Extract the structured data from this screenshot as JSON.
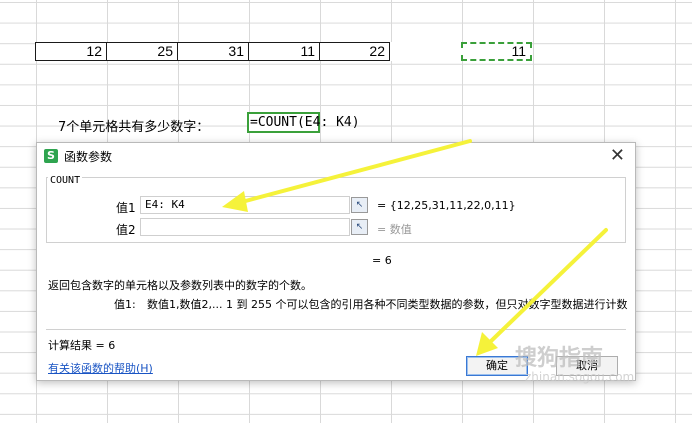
{
  "sheet": {
    "row_values": [
      "12",
      "25",
      "31",
      "11",
      "22",
      "",
      "11"
    ],
    "question": "7个单元格共有多少数字：",
    "formula": "=COUNT(E4: K4)"
  },
  "dialog": {
    "icon_label": "S",
    "title": "函数参数",
    "close_label": "✕",
    "function_name": "COUNT",
    "arg1_label": "值1",
    "arg1_value": "E4: K4",
    "arg1_result": "= {12,25,31,11,22,0,11}",
    "arg2_label": "值2",
    "arg2_value": "",
    "arg2_result": "= 数值",
    "ref_icon": "↖",
    "total_result": "= 6",
    "description": "返回包含数字的单元格以及参数列表中的数字的个数。",
    "param_name": "值1:",
    "param_description": "数值1,数值2,... 1 到 255 个可以包含的引用各种不同类型数据的参数，但只对数字型数据进行计数",
    "calc_result": "计算结果 = 6",
    "help_link": "有关该函数的帮助(H)",
    "ok_label": "确定",
    "cancel_label": "取消"
  },
  "watermark": {
    "text": "搜狗指南",
    "sub": "zhinan.sogou.com"
  },
  "colors": {
    "selection": "#3aa03a",
    "arrow": "#f5f23a",
    "link": "#1a55c4",
    "app_icon": "#2ea44f"
  }
}
